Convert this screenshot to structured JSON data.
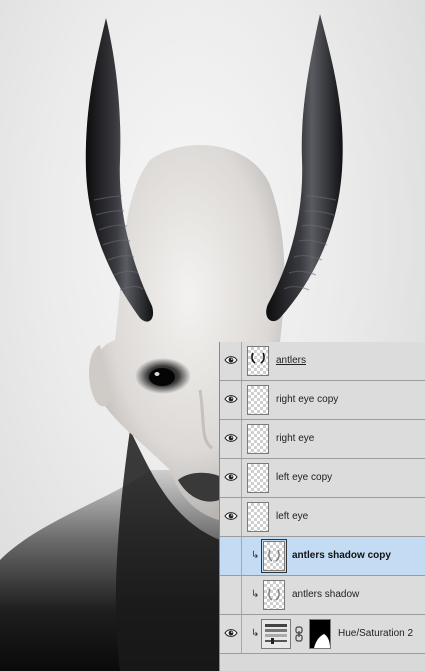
{
  "layers_panel": {
    "layers": [
      {
        "name": "antlers",
        "visible": true,
        "clipped": false,
        "selected": false,
        "thumbnail": "antlers"
      },
      {
        "name": "right eye copy",
        "visible": true,
        "clipped": false,
        "selected": false,
        "thumbnail": "transparent"
      },
      {
        "name": "right eye",
        "visible": true,
        "clipped": false,
        "selected": false,
        "thumbnail": "transparent"
      },
      {
        "name": "left eye copy",
        "visible": true,
        "clipped": false,
        "selected": false,
        "thumbnail": "transparent"
      },
      {
        "name": "left eye",
        "visible": true,
        "clipped": false,
        "selected": false,
        "thumbnail": "transparent"
      },
      {
        "name": "antlers shadow copy",
        "visible": false,
        "clipped": true,
        "selected": true,
        "thumbnail": "shadow"
      },
      {
        "name": "antlers shadow",
        "visible": false,
        "clipped": true,
        "selected": false,
        "thumbnail": "shadow"
      },
      {
        "name": "Hue/Saturation 2",
        "visible": true,
        "clipped": true,
        "selected": false,
        "thumbnail": "hue-saturation-adjustment"
      }
    ]
  },
  "colors": {
    "panel_bg": "#dcdcdc",
    "selected_row": "#c3dcf4",
    "divider": "#9c9c9c"
  },
  "icons": {
    "visibility": "eye-icon",
    "clipping": "clipping-mask-arrow-icon",
    "link": "mask-link-chain-icon"
  }
}
